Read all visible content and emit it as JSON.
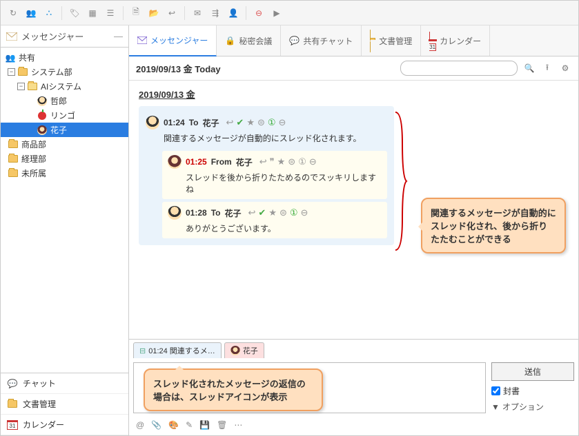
{
  "toolbar_icons": [
    "refresh",
    "user-pair",
    "user-group",
    "tag",
    "grid",
    "menu",
    "file",
    "folder-open",
    "reply-all",
    "mail-new",
    "thread",
    "user-badge",
    "no-entry",
    "flag-off"
  ],
  "sidebar": {
    "header": "メッセンジャー",
    "shared_label": "共有",
    "tree": {
      "system": "システム部",
      "ai": "AIシステム",
      "users": [
        "哲郎",
        "リンゴ",
        "花子"
      ],
      "sales": "商品部",
      "accounting": "経理部",
      "unassigned": "未所属"
    },
    "bottom": {
      "chat": "チャット",
      "docs": "文書管理",
      "calendar": "カレンダー",
      "calendar_day": "31"
    }
  },
  "tabs": {
    "messenger": "メッセンジャー",
    "secret": "秘密会議",
    "shared_chat": "共有チャット",
    "docs": "文書管理",
    "calendar": "カレンダー",
    "calendar_day": "31"
  },
  "header": {
    "date_title": "2019/09/13 金 Today",
    "search_placeholder": ""
  },
  "messages": {
    "date": "2019/09/13 金",
    "m1": {
      "time": "01:24",
      "dir": "To",
      "who": "花子",
      "body": "関連するメッセージが自動的にスレッド化されます。"
    },
    "m2": {
      "time": "01:25",
      "dir": "From",
      "who": "花子",
      "body": "スレッドを後から折りたためるのでスッキリしますね"
    },
    "m3": {
      "time": "01:28",
      "dir": "To",
      "who": "花子",
      "body": "ありがとうございます。"
    }
  },
  "callout1": "関連するメッセージが自動的にスレッド化され、後から折りたたむことができる",
  "compose": {
    "tab1": "01:24 関連するメ…",
    "tab2": "花子",
    "send": "送信",
    "sealed": "封書",
    "option": "オプション"
  },
  "callout2": "スレッド化されたメッセージの返信の場合は、スレッドアイコンが表示"
}
